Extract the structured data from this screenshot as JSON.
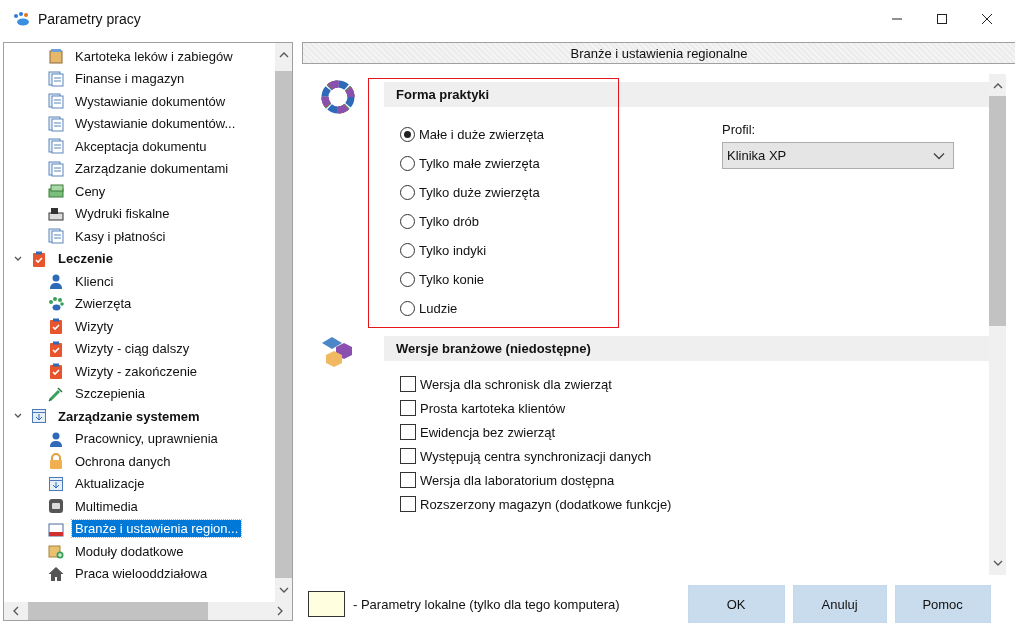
{
  "window": {
    "title": "Parametry pracy"
  },
  "tree": {
    "top_items": [
      {
        "label": "Kartoteka leków i zabiegów",
        "kind": "box",
        "selected": false
      },
      {
        "label": "Finanse i magazyn",
        "kind": "document",
        "selected": false
      },
      {
        "label": "Wystawianie dokumentów",
        "kind": "document",
        "selected": false
      },
      {
        "label": "Wystawianie dokumentów...",
        "kind": "document",
        "selected": false
      },
      {
        "label": "Akceptacja dokumentu",
        "kind": "document",
        "selected": false
      },
      {
        "label": "Zarządzanie dokumentami",
        "kind": "document",
        "selected": false
      },
      {
        "label": "Ceny",
        "kind": "coins",
        "selected": false
      },
      {
        "label": "Wydruki fiskalne",
        "kind": "printer",
        "selected": false
      },
      {
        "label": "Kasy i płatności",
        "kind": "document",
        "selected": false
      }
    ],
    "groups": [
      {
        "label": "Leczenie",
        "kind": "clipboard",
        "expanded": true,
        "children": [
          {
            "label": "Klienci",
            "kind": "person",
            "selected": false
          },
          {
            "label": "Zwierzęta",
            "kind": "paw",
            "selected": false
          },
          {
            "label": "Wizyty",
            "kind": "clipboard",
            "selected": false
          },
          {
            "label": "Wizyty - ciąg dalszy",
            "kind": "clipboard",
            "selected": false
          },
          {
            "label": "Wizyty - zakończenie",
            "kind": "clipboard",
            "selected": false
          },
          {
            "label": "Szczepienia",
            "kind": "syringe",
            "selected": false
          }
        ]
      },
      {
        "label": "Zarządzanie systemem",
        "kind": "update",
        "expanded": true,
        "children": [
          {
            "label": "Pracownicy, uprawnienia",
            "kind": "person",
            "selected": false
          },
          {
            "label": "Ochrona danych",
            "kind": "lock",
            "selected": false
          },
          {
            "label": "Aktualizacje",
            "kind": "update",
            "selected": false
          },
          {
            "label": "Multimedia",
            "kind": "media",
            "selected": false
          },
          {
            "label": "Branże i ustawienia region...",
            "kind": "folder",
            "selected": true
          },
          {
            "label": "Moduły dodatkowe",
            "kind": "box",
            "selected": false
          },
          {
            "label": "Praca wielooddziałowa",
            "kind": "house",
            "selected": false
          }
        ]
      }
    ]
  },
  "panel": {
    "title": "Branże i ustawienia regionalne",
    "practice_form": {
      "title": "Forma praktyki",
      "options": [
        {
          "label": "Małe i duże zwierzęta",
          "selected": true
        },
        {
          "label": "Tylko małe zwierzęta",
          "selected": false
        },
        {
          "label": "Tylko duże zwierzęta",
          "selected": false
        },
        {
          "label": "Tylko drób",
          "selected": false
        },
        {
          "label": "Tylko indyki",
          "selected": false
        },
        {
          "label": "Tylko konie",
          "selected": false
        },
        {
          "label": "Ludzie",
          "selected": false
        }
      ]
    },
    "profile": {
      "label": "Profil:",
      "value": "Klinika XP"
    },
    "versions": {
      "title": "Wersje branżowe (niedostępne)",
      "options": [
        {
          "label": "Wersja dla schronisk dla zwierząt",
          "checked": false
        },
        {
          "label": "Prosta kartoteka klientów",
          "checked": false
        },
        {
          "label": "Ewidencja bez zwierząt",
          "checked": false
        },
        {
          "label": "Występują centra synchronizacji danych",
          "checked": false
        },
        {
          "label": "Wersja dla laboratorium dostępna",
          "checked": false
        },
        {
          "label": "Rozszerzony magazyn (dodatkowe funkcje)",
          "checked": false
        }
      ]
    }
  },
  "legend": {
    "text": "- Parametry lokalne (tylko dla tego komputera)"
  },
  "buttons": [
    "OK",
    "Anuluj",
    "Pomoc"
  ]
}
